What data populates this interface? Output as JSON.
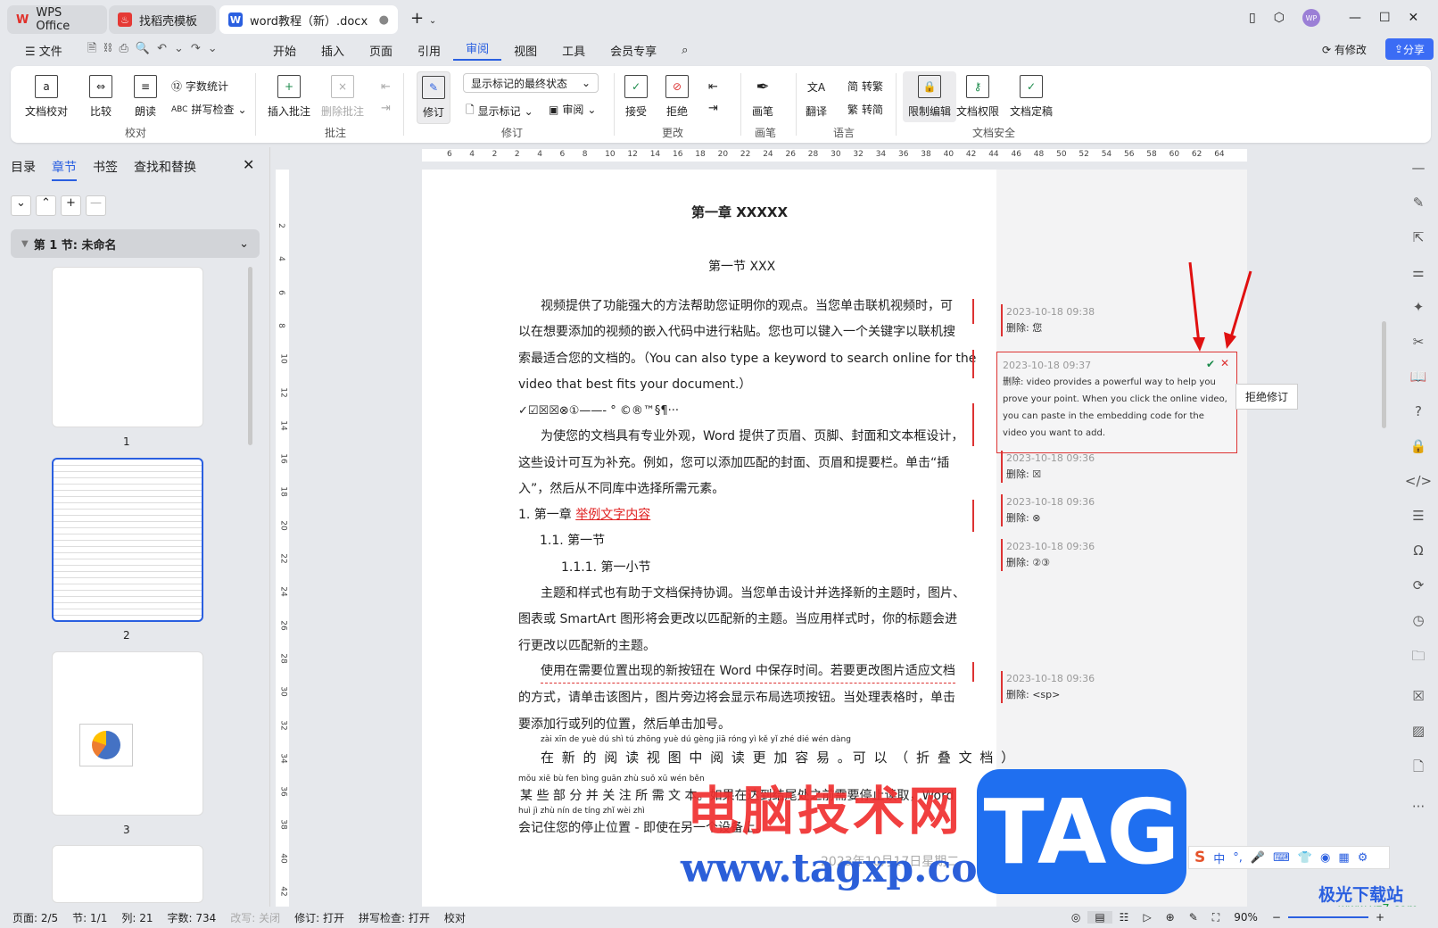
{
  "tabs": [
    {
      "label": "WPS Office"
    },
    {
      "label": "找稻壳模板"
    },
    {
      "label": "word教程（新）.docx"
    }
  ],
  "menu": {
    "file": "文件",
    "items": [
      "开始",
      "插入",
      "页面",
      "引用",
      "审阅",
      "视图",
      "工具",
      "会员专享"
    ],
    "modified": "有修改",
    "share": "分享"
  },
  "ribbon": {
    "jiaodui": {
      "doc_check": "文档校对",
      "compare": "比较",
      "read": "朗读",
      "word_count": "字数统计",
      "spell": "拼写检查",
      "group": "校对"
    },
    "pizhu": {
      "insert": "插入批注",
      "delete": "删除批注",
      "group": "批注"
    },
    "xiuding": {
      "track": "修订",
      "display_select": "显示标记的最终状态",
      "show_marks": "显示标记",
      "review": "审阅",
      "group": "修订"
    },
    "genggai": {
      "accept": "接受",
      "reject": "拒绝",
      "group": "更改"
    },
    "huabi": {
      "pen": "画笔",
      "group": "画笔"
    },
    "yuyan": {
      "translate": "翻译",
      "to_trad": "转繁",
      "to_simp": "转简",
      "group": "语言"
    },
    "security": {
      "restrict": "限制编辑",
      "permission": "文档权限",
      "finalize": "文档定稿",
      "group": "文档安全"
    }
  },
  "left": {
    "tabs": [
      "目录",
      "章节",
      "书签",
      "查找和替换"
    ],
    "section": "第 1 节: 未命名",
    "pages": [
      "1",
      "2",
      "3"
    ]
  },
  "ruler": [
    "6",
    "4",
    "2",
    "2",
    "4",
    "6",
    "8",
    "10",
    "12",
    "14",
    "16",
    "18",
    "20",
    "22",
    "24",
    "26",
    "28",
    "30",
    "32",
    "34",
    "36",
    "38",
    "40",
    "42",
    "44",
    "46",
    "48",
    "50",
    "52",
    "54",
    "56",
    "58",
    "60",
    "62",
    "64"
  ],
  "vruler": [
    "2",
    "4",
    "6",
    "8",
    "10",
    "12",
    "14",
    "16",
    "18",
    "20",
    "22",
    "24",
    "26",
    "28",
    "30",
    "32",
    "34",
    "36",
    "38",
    "40",
    "42"
  ],
  "doc": {
    "h1": "第一章  XXXXX",
    "h2": "第一节  XXX",
    "p1": [
      "视频提供了功能强大的方法帮助您证明你的观点。当您单击联机视频时，可",
      "以在想要添加的视频的嵌入代码中进行粘贴。您也可以键入一个关键字以联机搜",
      "索最适合您的文档的。（You can also type a keyword to search online for the",
      "video that best fits your document.）"
    ],
    "symbols": "✓☑☒☒⊗①——-    °   ©®™§¶···",
    "p2": [
      "为使您的文档具有专业外观，Word 提供了页眉、页脚、封面和文本框设计，",
      "这些设计可互为补充。例如，您可以添加匹配的封面、页眉和提要栏。单击“插",
      "入”，然后从不同库中选择所需元素。"
    ],
    "l1": "1.   第一章 ",
    "l1red": "举例文字内容",
    "l2": "1.1.  第一节",
    "l3": "1.1.1.   第一小节",
    "p3": [
      "主题和样式也有助于文档保持协调。当您单击设计并选择新的主题时，图片、",
      "图表或 SmartArt 图形将会更改以匹配新的主题。当应用样式时，你的标题会进",
      "行更改以匹配新的主题。"
    ],
    "p4": [
      "使用在需要位置出现的新按钮在 Word 中保存时间。若要更改图片适应文档",
      "的方式，请单击该图片，图片旁边将会显示布局选项按钮。当处理表格时，单击",
      "要添加行或列的位置，然后单击加号。"
    ],
    "py1": "zài  xīn  de  yuè  dú  shì  tú  zhōng yuè  dú  gèng  jiā  róng  yì      kě   yǐ      zhé  dié  wén dàng",
    "r1": "在 新 的 阅 读 视 图 中 阅 读 更 加 容 易 。可 以 （ 折 叠 文 档 ）",
    "py2": "mǒu xiē  bù  fen bìng guān zhù suǒ  xū  wén běn",
    "r2": "某 些 部 分 并 关 注 所 需 文 本。如果在达到结尾处之前需要停止读取，Word",
    "py3": "huì  jì   zhù  nín  de  tíng  zhǐ  wèi  zhì",
    "r3": "会记住您的停止位置 - 即使在另一个设备上。",
    "date": "2023年10月17日星期二"
  },
  "comments": [
    {
      "time": "2023-10-18 09:38",
      "text": "删除: 您"
    },
    {
      "time": "2023-10-18 09:37",
      "text": "删除: video provides a powerful way to help you prove your point. When you click the online video, you can paste in the embedding code for the video you want to add."
    },
    {
      "time": "2023-10-18 09:36",
      "text": "删除: ☒"
    },
    {
      "time": "2023-10-18 09:36",
      "text": "删除: ⊗"
    },
    {
      "time": "2023-10-18 09:36",
      "text": "删除: ②③"
    },
    {
      "time": "2023-10-18 09:36",
      "text": "删除: <sp>"
    }
  ],
  "tooltip": "拒绝修订",
  "status": {
    "page": "页面: 2/5",
    "section": "节: 1/1",
    "col": "列: 21",
    "words": "字数: 734",
    "rewrite": "改写: 关闭",
    "track": "修订: 打开",
    "spell": "拼写检查: 打开",
    "proof": "校对",
    "zoom": "90%"
  },
  "ime": {
    "lang": "中"
  },
  "watermarks": {
    "cn": "电脑技术网",
    "url": "www.tagxp.com",
    "tag": "TAG",
    "site": "极光下载站",
    "site_url": "www.xz7.com"
  },
  "colors": {
    "accent": "#2a5fe0",
    "revision": "#d33333"
  }
}
